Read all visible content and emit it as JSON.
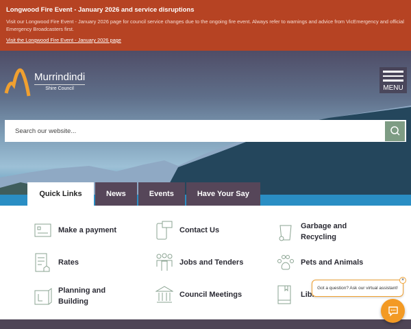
{
  "alert": {
    "title": "Longwood Fire Event - January 2026 and service disruptions",
    "body": "Visit our Longwood Fire Event - January 2026 page for council service changes due to the ongoing fire event. Always refer to warnings and advice from VicEmergency and official Emergency Broadcasters first.",
    "link": "Visit the Longwood Fire Event - January 2026 page"
  },
  "logo": {
    "name": "Murrindindi",
    "sub": "Shire Council"
  },
  "menu_label": "MENU",
  "search": {
    "placeholder": "Search our website..."
  },
  "tabs": [
    "Quick Links",
    "News",
    "Events",
    "Have Your Say"
  ],
  "quick_links": [
    "Make a payment",
    "Contact Us",
    "Garbage and Recycling",
    "Rates",
    "Jobs and Tenders",
    "Pets and Animals",
    "Planning and Building",
    "Council Meetings",
    "Libraries"
  ],
  "chat": {
    "prompt": "Got a question? Ask our virtual assistant!",
    "close": "×"
  }
}
